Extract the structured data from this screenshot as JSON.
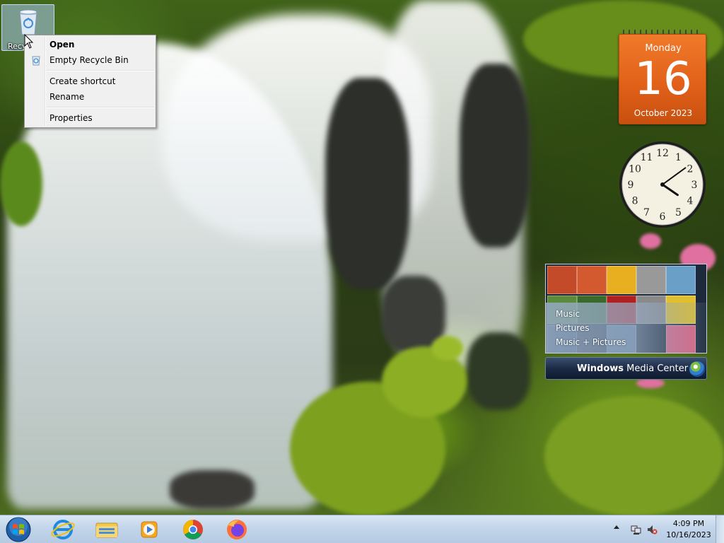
{
  "desktop": {
    "icons": [
      {
        "label": "Recycle Bin",
        "icon": "recycle-bin-icon"
      }
    ]
  },
  "context_menu": {
    "items": [
      {
        "label": "Open",
        "bold": true
      },
      {
        "label": "Empty Recycle Bin",
        "icon": "recycle-bin-icon"
      },
      {
        "label": "Create shortcut"
      },
      {
        "label": "Rename"
      },
      {
        "label": "Properties"
      }
    ]
  },
  "calendar_gadget": {
    "day": "Monday",
    "date": "16",
    "month_year": "October 2023",
    "color": "#e8651c"
  },
  "clock_gadget": {
    "numbers": [
      "12",
      "1",
      "2",
      "3",
      "4",
      "5",
      "6",
      "7",
      "8",
      "9",
      "10",
      "11"
    ],
    "hour": 4,
    "minute": 9
  },
  "media_center_gadget": {
    "items": [
      "Music",
      "Pictures",
      "Music + Pictures"
    ],
    "title_prefix": "Windows",
    "title_suffix": " Media Center"
  },
  "taskbar": {
    "start_icon": "windows-start-orb-icon",
    "pinned": [
      {
        "name": "internet-explorer-icon"
      },
      {
        "name": "file-explorer-icon"
      },
      {
        "name": "windows-media-player-icon"
      },
      {
        "name": "chrome-icon"
      },
      {
        "name": "firefox-icon"
      }
    ],
    "tray": {
      "icons": [
        "show-hidden-icons-icon",
        "network-icon",
        "volume-muted-icon"
      ],
      "time": "4:09 PM",
      "date": "10/16/2023"
    }
  }
}
